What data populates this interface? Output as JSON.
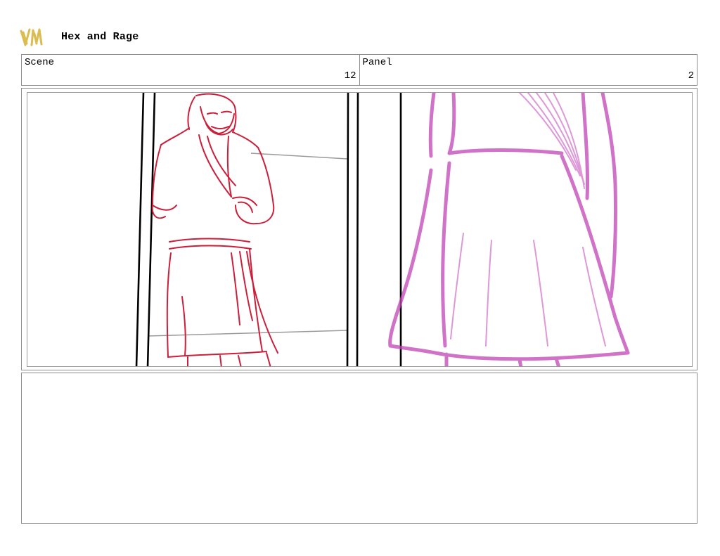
{
  "header": {
    "logo_icon": "vm-logo-icon",
    "title": "Hex and Rage"
  },
  "info": {
    "scene_label": "Scene",
    "scene_value": "12",
    "panel_label": "Panel",
    "panel_value": "2"
  },
  "frame": {
    "image": "storyboard-sketch",
    "colors": {
      "figure_red": "#cc1f3a",
      "figure_magenta": "#c244b8",
      "frame_lines": "#000000",
      "logo_gold": "#d9b53c"
    }
  },
  "notes": {
    "text": ""
  }
}
